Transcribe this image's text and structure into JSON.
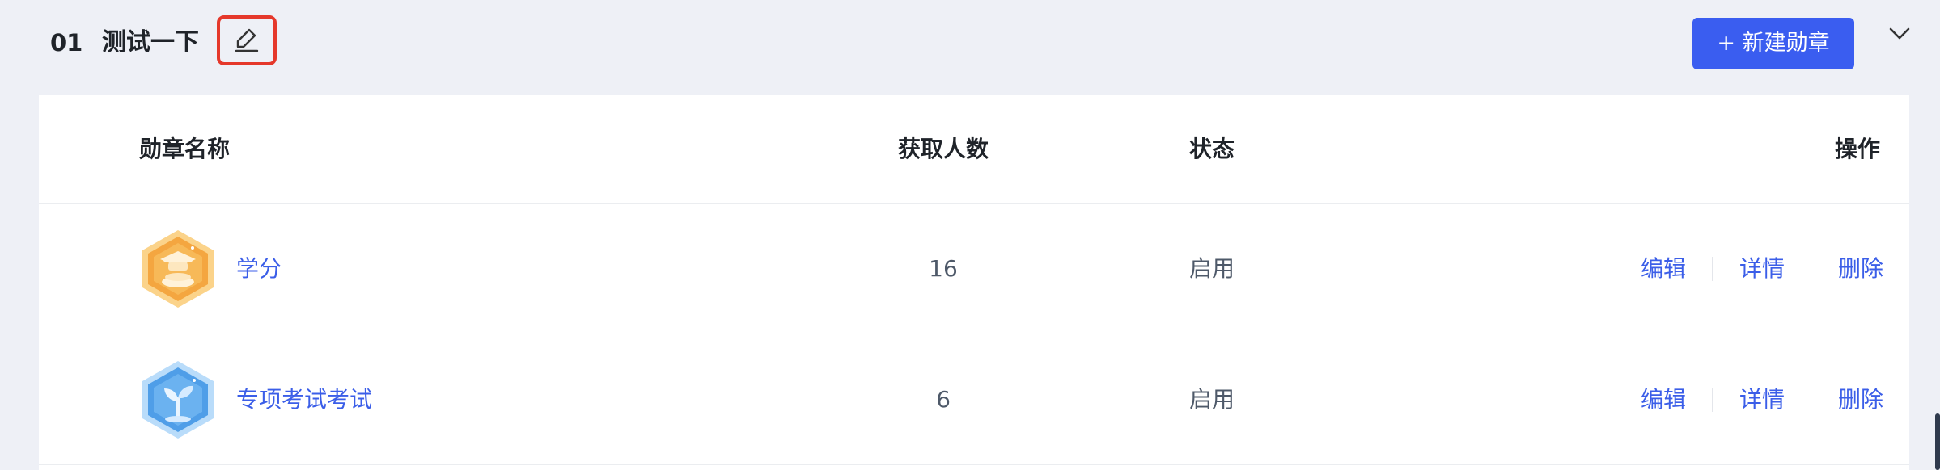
{
  "group": {
    "number": "01",
    "title": "测试一下"
  },
  "toolbar": {
    "new_badge_label": "+ 新建勋章"
  },
  "table": {
    "columns": {
      "name": "勋章名称",
      "count": "获取人数",
      "status": "状态",
      "actions": "操作"
    },
    "rows": [
      {
        "name": "学分",
        "count": "16",
        "status": "启用",
        "icon": "graduation-cap-badge-icon",
        "icon_color": "#f4a640"
      },
      {
        "name": "专项考试考试",
        "count": "6",
        "status": "启用",
        "icon": "sprout-badge-icon",
        "icon_color": "#4f9ee8"
      }
    ],
    "actions": {
      "edit": "编辑",
      "detail": "详情",
      "delete": "删除"
    }
  },
  "colors": {
    "accent": "#3a5df0",
    "link": "#3b5ee8",
    "highlight_border": "#e5382b",
    "header_bg": "#eef0f6"
  }
}
